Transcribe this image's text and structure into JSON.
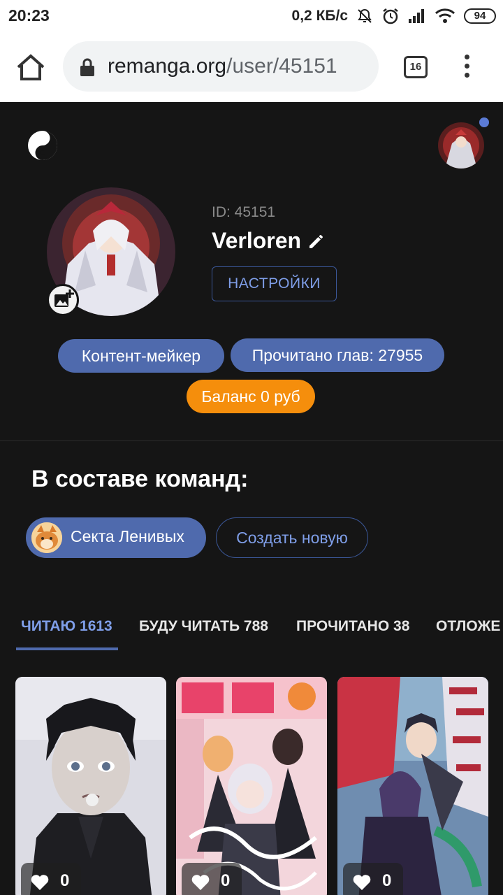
{
  "status_bar": {
    "time": "20:23",
    "speed": "0,2 КБ/с",
    "battery": "94",
    "icons": [
      "mute-icon",
      "alarm-icon",
      "signal-icon",
      "wifi-icon",
      "battery-icon"
    ]
  },
  "browser": {
    "url_domain": "remanga.org",
    "url_path": "/user/45151",
    "tab_count": "16"
  },
  "profile": {
    "id_label": "ID: 45151",
    "username": "Verloren",
    "settings_label": "НАСТРОЙКИ"
  },
  "badges": {
    "role": "Контент-мейкер",
    "chapters_read": "Прочитано глав: 27955",
    "balance": "Баланс 0 руб"
  },
  "teams": {
    "title": "В составе команд:",
    "team_name": "Секта Ленивых",
    "create_label": "Создать новую"
  },
  "tabs": [
    {
      "label": "ЧИТАЮ 1613",
      "active": true
    },
    {
      "label": "БУДУ ЧИТАТЬ 788",
      "active": false
    },
    {
      "label": "ПРОЧИТАНО 38",
      "active": false
    },
    {
      "label": "ОТЛОЖЕ",
      "active": false
    }
  ],
  "cards": [
    {
      "likes": "0"
    },
    {
      "likes": "0"
    },
    {
      "likes": "0"
    }
  ],
  "colors": {
    "accent": "#4f6aad",
    "accent_text": "#7f9ee8",
    "orange": "#f58e0c",
    "background": "#151515"
  }
}
